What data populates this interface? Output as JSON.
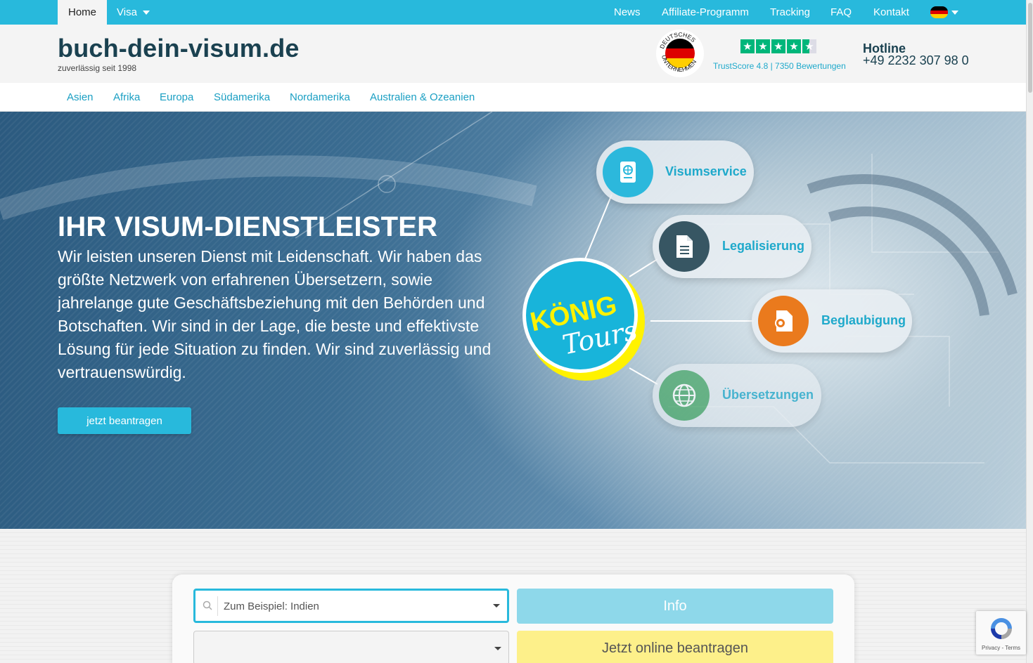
{
  "topbar": {
    "home": "Home",
    "visa": "Visa",
    "links": [
      "News",
      "Affiliate-Programm",
      "Tracking",
      "FAQ",
      "Kontakt"
    ]
  },
  "header": {
    "brand": "buch-dein-visum.de",
    "tagline": "zuverlässig seit 1998",
    "seal_text": "DEUTSCHES UNTERNEHMEN",
    "trust_text": "TrustScore 4.8 | 7350 Bewertungen",
    "trust_stars": 4.5,
    "hotline_title": "Hotline",
    "hotline_number": "+49 2232 307 98 0"
  },
  "regions": [
    "Asien",
    "Afrika",
    "Europa",
    "Südamerika",
    "Nordamerika",
    "Australien & Ozeanien"
  ],
  "hero": {
    "title": "IHR VISUM-DIENSTLEISTER",
    "text": "Wir leisten unseren Dienst mit Leidenschaft. Wir haben das größte Netzwerk von erfahrenen Übersetzern, sowie jahrelange gute Geschäftsbeziehung mit den Behörden und Botschaften. Wir sind in der Lage, die beste und effektivste Lösung für jede Situation zu finden. Wir sind zuverlässig und vertrauenswürdig.",
    "button": "jetzt beantragen",
    "logo_line1": "KÖNIG",
    "logo_line2": "Tours",
    "services": [
      "Visumservice",
      "Legalisierung",
      "Beglaubigung",
      "Übersetzungen"
    ]
  },
  "form": {
    "country_placeholder": "Zum Beispiel: Indien",
    "visa_placeholder": "",
    "info_button": "Info",
    "apply_button": "Jetzt online beantragen"
  },
  "recaptcha": {
    "text": "Privacy - Terms"
  },
  "colors": {
    "accent": "#28b9dc",
    "brand": "#1a4150",
    "trustpilot": "#00b67a",
    "apply": "#fdf08a"
  }
}
